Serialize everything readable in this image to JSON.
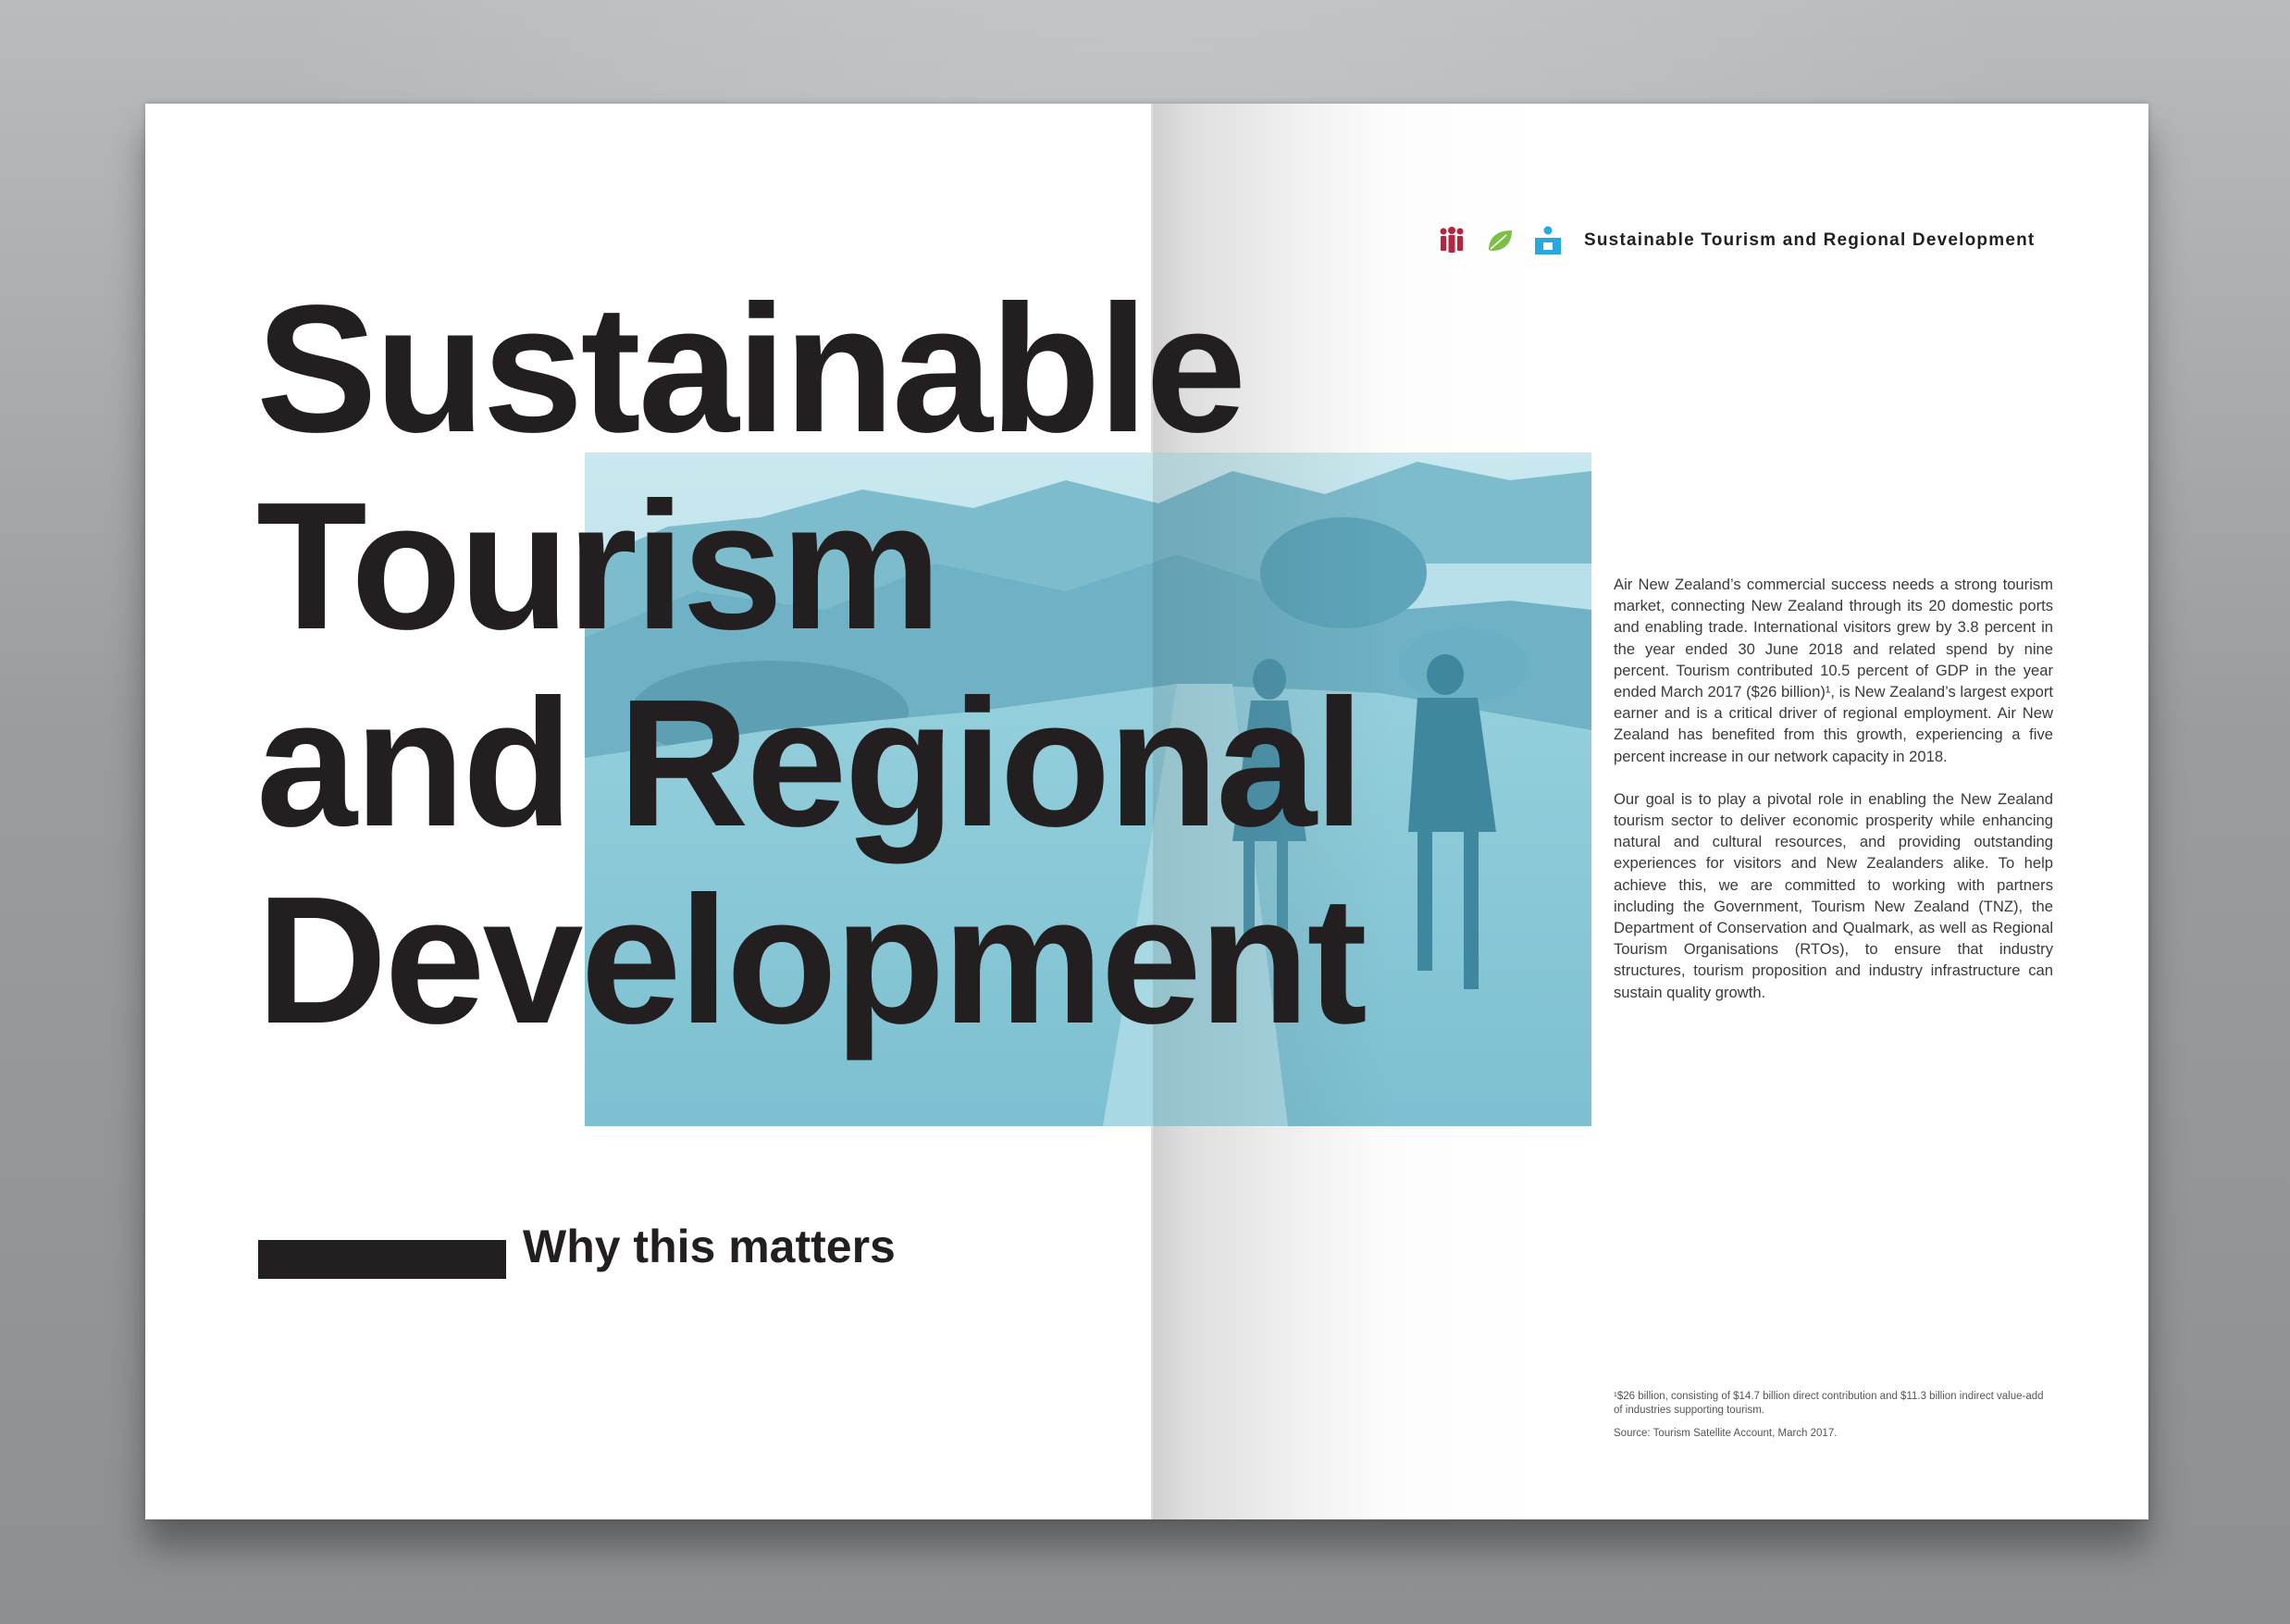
{
  "section_header": {
    "title": "Sustainable Tourism and Regional Development",
    "icons": [
      "people-icon",
      "leaf-icon",
      "tourism-map-icon"
    ],
    "icon_colors": {
      "people": "#b5253f",
      "leaf": "#7ac143",
      "tourism": "#29a8df"
    }
  },
  "headline": {
    "line1": "Sustainable",
    "line2": "Tourism",
    "line3": "and Regional",
    "line4": "Development"
  },
  "subheading": "Why this matters",
  "body": {
    "p1": "Air New Zealand’s commercial success needs a strong tourism market, connecting New Zealand through its 20 domestic ports and enabling trade. International visitors grew by 3.8 percent in the year ended 30 June 2018 and related spend by nine percent. Tourism contributed 10.5 percent of GDP in the year ended March 2017 ($26 billion)¹, is New Zealand’s largest export earner and is a critical driver of regional employment. Air New Zealand has benefited from this growth, experiencing a five percent increase in our network capacity in 2018.",
    "p2": "Our goal is to play a pivotal role in enabling the New Zealand tourism sector to deliver economic prosperity while enhancing natural and cultural resources, and providing outstanding experiences for visitors and New Zealanders alike. To help achieve this, we are committed to working with partners including the Government, Tourism New Zealand (TNZ), the Department of Conservation and Qualmark, as well as Regional Tourism Organisations (RTOs), to ensure that industry structures, tourism proposition and industry infrastructure can sustain quality growth."
  },
  "footnote": {
    "note": "¹$26 billion, consisting of $14.7 billion direct contribution and $11.3 billion indirect value-add of industries supporting tourism.",
    "source": "Source: Tourism Satellite Account, March 2017."
  },
  "colors": {
    "text": "#231f20",
    "photo_tint": "#8fcad8"
  }
}
